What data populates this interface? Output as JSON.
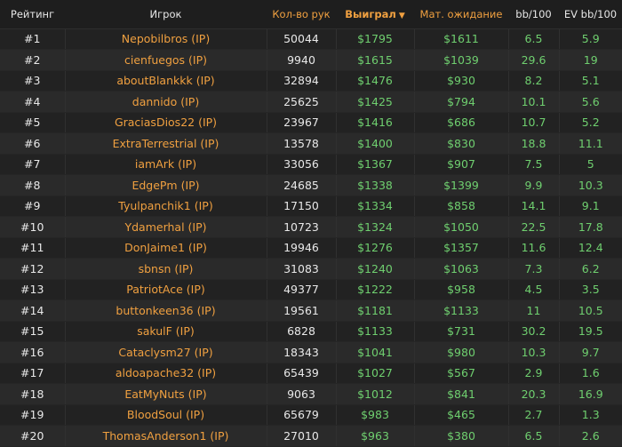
{
  "header": {
    "rank": "Рейтинг",
    "player": "Игрок",
    "hands": "Кол-во рук",
    "won": "Выиграл",
    "won_sort_icon": "sort-down-icon",
    "ev": "Мат. ожидание",
    "bb100": "bb/100",
    "evbb100": "EV bb/100"
  },
  "rows": [
    {
      "rank": "#1",
      "player": "Nepobilbros (IP)",
      "hands": "50044",
      "won": "$1795",
      "ev": "$1611",
      "bb": "6.5",
      "evbb": "5.9"
    },
    {
      "rank": "#2",
      "player": "cienfuegos (IP)",
      "hands": "9940",
      "won": "$1615",
      "ev": "$1039",
      "bb": "29.6",
      "evbb": "19"
    },
    {
      "rank": "#3",
      "player": "aboutBlankkk (IP)",
      "hands": "32894",
      "won": "$1476",
      "ev": "$930",
      "bb": "8.2",
      "evbb": "5.1"
    },
    {
      "rank": "#4",
      "player": "dannido (IP)",
      "hands": "25625",
      "won": "$1425",
      "ev": "$794",
      "bb": "10.1",
      "evbb": "5.6"
    },
    {
      "rank": "#5",
      "player": "GraciasDios22 (IP)",
      "hands": "23967",
      "won": "$1416",
      "ev": "$686",
      "bb": "10.7",
      "evbb": "5.2"
    },
    {
      "rank": "#6",
      "player": "ExtraTerrestrial (IP)",
      "hands": "13578",
      "won": "$1400",
      "ev": "$830",
      "bb": "18.8",
      "evbb": "11.1"
    },
    {
      "rank": "#7",
      "player": "iamArk (IP)",
      "hands": "33056",
      "won": "$1367",
      "ev": "$907",
      "bb": "7.5",
      "evbb": "5"
    },
    {
      "rank": "#8",
      "player": "EdgePm (IP)",
      "hands": "24685",
      "won": "$1338",
      "ev": "$1399",
      "bb": "9.9",
      "evbb": "10.3"
    },
    {
      "rank": "#9",
      "player": "Tyulpanchik1 (IP)",
      "hands": "17150",
      "won": "$1334",
      "ev": "$858",
      "bb": "14.1",
      "evbb": "9.1"
    },
    {
      "rank": "#10",
      "player": "Ydamerhal (IP)",
      "hands": "10723",
      "won": "$1324",
      "ev": "$1050",
      "bb": "22.5",
      "evbb": "17.8"
    },
    {
      "rank": "#11",
      "player": "DonJaime1 (IP)",
      "hands": "19946",
      "won": "$1276",
      "ev": "$1357",
      "bb": "11.6",
      "evbb": "12.4"
    },
    {
      "rank": "#12",
      "player": "sbnsn (IP)",
      "hands": "31083",
      "won": "$1240",
      "ev": "$1063",
      "bb": "7.3",
      "evbb": "6.2"
    },
    {
      "rank": "#13",
      "player": "PatriotAce (IP)",
      "hands": "49377",
      "won": "$1222",
      "ev": "$958",
      "bb": "4.5",
      "evbb": "3.5"
    },
    {
      "rank": "#14",
      "player": "buttonkeen36 (IP)",
      "hands": "19561",
      "won": "$1181",
      "ev": "$1133",
      "bb": "11",
      "evbb": "10.5"
    },
    {
      "rank": "#15",
      "player": "sakulF (IP)",
      "hands": "6828",
      "won": "$1133",
      "ev": "$731",
      "bb": "30.2",
      "evbb": "19.5"
    },
    {
      "rank": "#16",
      "player": "Cataclysm27 (IP)",
      "hands": "18343",
      "won": "$1041",
      "ev": "$980",
      "bb": "10.3",
      "evbb": "9.7"
    },
    {
      "rank": "#17",
      "player": "aldoapache32 (IP)",
      "hands": "65439",
      "won": "$1027",
      "ev": "$567",
      "bb": "2.9",
      "evbb": "1.6"
    },
    {
      "rank": "#18",
      "player": "EatMyNuts (IP)",
      "hands": "9063",
      "won": "$1012",
      "ev": "$841",
      "bb": "20.3",
      "evbb": "16.9"
    },
    {
      "rank": "#19",
      "player": "BloodSoul (IP)",
      "hands": "65679",
      "won": "$983",
      "ev": "$465",
      "bb": "2.7",
      "evbb": "1.3"
    },
    {
      "rank": "#20",
      "player": "ThomasAnderson1 (IP)",
      "hands": "27010",
      "won": "$963",
      "ev": "$380",
      "bb": "6.5",
      "evbb": "2.6"
    }
  ],
  "colors": {
    "accent_orange": "#f0a040",
    "value_green": "#6fcf6f",
    "row_odd": "#222222",
    "row_even": "#2a2a2a"
  }
}
